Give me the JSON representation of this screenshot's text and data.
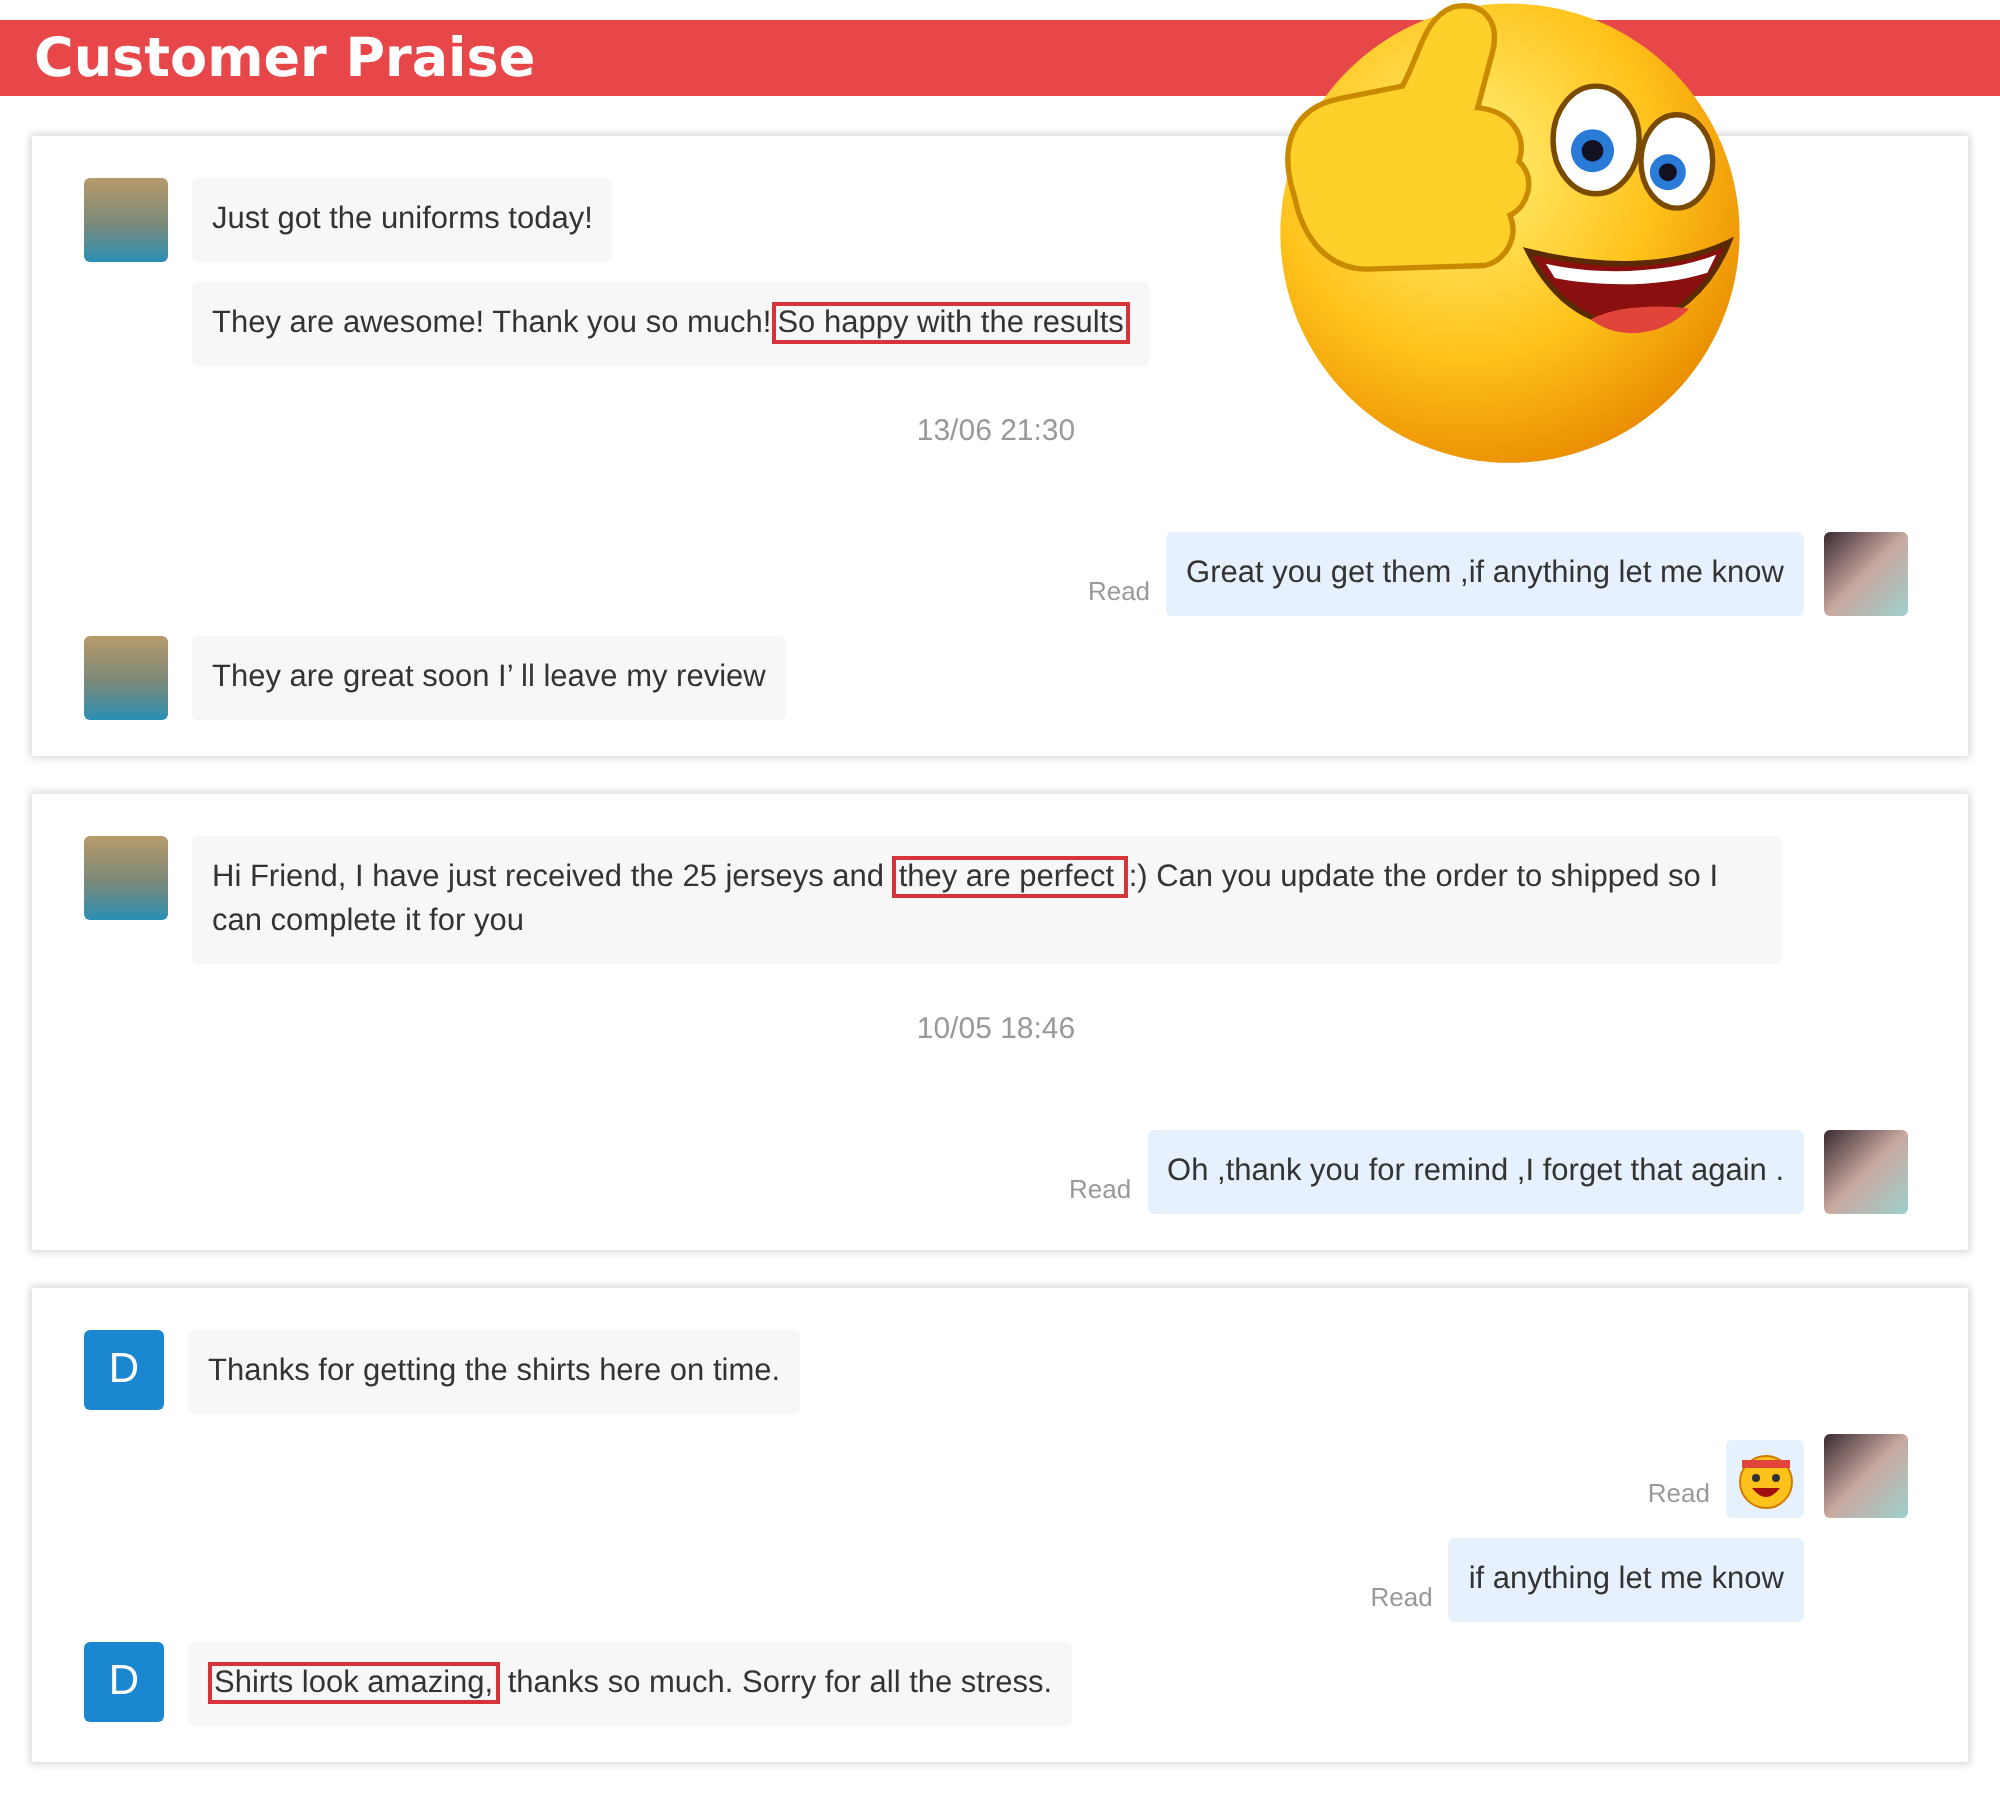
{
  "header": {
    "title": "Customer Praise"
  },
  "cards": [
    {
      "items": [
        {
          "kind": "message",
          "outgoing": false,
          "avatar": {
            "kind": "photo"
          },
          "segments": [
            {
              "text": "Just got the uniforms today!",
              "highlighted": false
            }
          ]
        },
        {
          "kind": "message",
          "outgoing": false,
          "segments": [
            {
              "text": "They are awesome! Thank you so much!",
              "highlighted": false
            },
            {
              "text": "So happy with the results",
              "highlighted": true
            }
          ]
        },
        {
          "kind": "time",
          "text": "13/06 21:30"
        },
        {
          "kind": "message",
          "outgoing": true,
          "read": "Read",
          "avatar": {
            "kind": "photo"
          },
          "segments": [
            {
              "text": "Great you get them ,if anything let me know",
              "highlighted": false
            }
          ]
        },
        {
          "kind": "message",
          "outgoing": false,
          "avatar": {
            "kind": "photo"
          },
          "segments": [
            {
              "text": "They are great soon I’ ll leave my review",
              "highlighted": false
            }
          ]
        }
      ]
    },
    {
      "items": [
        {
          "kind": "message",
          "outgoing": false,
          "avatar": {
            "kind": "photo"
          },
          "segments": [
            {
              "text": "Hi Friend, I have just received the 25 jerseys and ",
              "highlighted": false
            },
            {
              "text": "they are perfect ",
              "highlighted": true
            },
            {
              "text": ":) Can you update the order to shipped so I can complete it for you",
              "highlighted": false
            }
          ]
        },
        {
          "kind": "time",
          "text": "10/05 18:46"
        },
        {
          "kind": "message",
          "outgoing": true,
          "read": "Read",
          "avatar": {
            "kind": "photo"
          },
          "segments": [
            {
              "text": "Oh ,thank you for remind ,I forget that again .",
              "highlighted": false
            }
          ]
        }
      ]
    },
    {
      "items": [
        {
          "kind": "message",
          "outgoing": false,
          "avatar": {
            "kind": "letter",
            "letter": "D"
          },
          "segments": [
            {
              "text": "Thanks for getting the shirts here on time.",
              "highlighted": false
            }
          ]
        },
        {
          "kind": "sticker",
          "outgoing": true,
          "read": "Read",
          "avatar": {
            "kind": "photo"
          }
        },
        {
          "kind": "message",
          "outgoing": true,
          "read": "Read",
          "segments": [
            {
              "text": "if anything let me know",
              "highlighted": false
            }
          ]
        },
        {
          "kind": "message",
          "outgoing": false,
          "avatar": {
            "kind": "letter",
            "letter": "D"
          },
          "segments": [
            {
              "text": "Shirts look amazing,",
              "highlighted": true
            },
            {
              "text": " thanks so much. Sorry for all the stress.",
              "highlighted": false
            }
          ]
        }
      ]
    }
  ]
}
